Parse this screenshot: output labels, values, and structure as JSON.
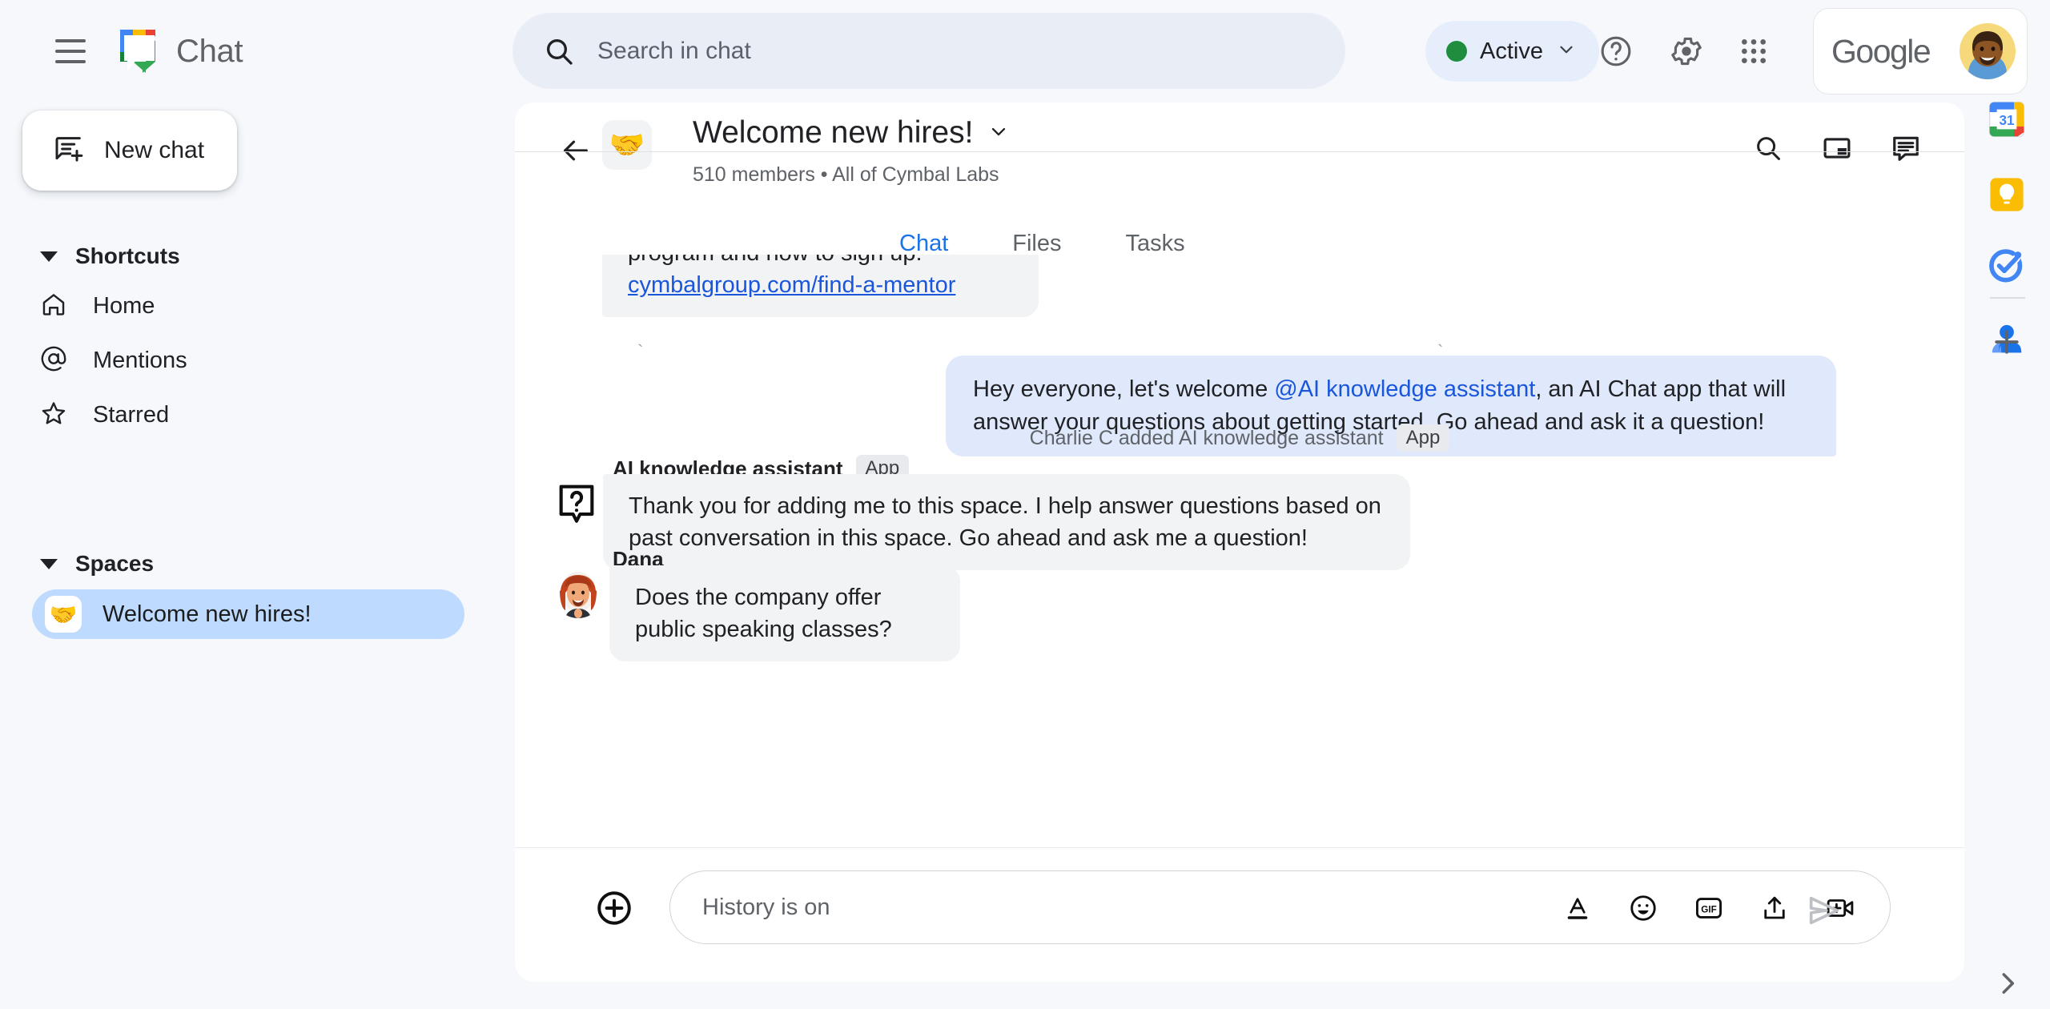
{
  "app": {
    "brand_name": "Chat",
    "menu_icon": "hamburger-icon",
    "logo_icon": "google-chat-logo"
  },
  "search": {
    "placeholder": "Search in chat",
    "icon": "search-icon"
  },
  "status": {
    "label": "Active",
    "color": "#1e8e3e",
    "chevron": "chevron-down-icon"
  },
  "topbar_icons": {
    "help": "help-circle-icon",
    "settings": "gear-icon",
    "apps": "apps-grid-icon"
  },
  "account": {
    "brand": "Google",
    "avatar": "user-avatar"
  },
  "sidebar": {
    "new_chat": {
      "label": "New chat",
      "icon": "new-chat-icon"
    },
    "shortcuts": {
      "title": "Shortcuts",
      "items": [
        {
          "label": "Home",
          "icon": "home-icon"
        },
        {
          "label": "Mentions",
          "icon": "at-sign-icon"
        },
        {
          "label": "Starred",
          "icon": "star-icon"
        }
      ]
    },
    "spaces": {
      "title": "Spaces",
      "items": [
        {
          "label": "Welcome new hires!",
          "emoji": "🤝",
          "selected": true
        }
      ]
    }
  },
  "conversation": {
    "back_icon": "back-arrow-icon",
    "emoji": "🤝",
    "title": "Welcome new hires!",
    "title_chevron": "chevron-down-icon",
    "subtitle": "510 members  •  All of Cymbal Labs",
    "member_count": "510 members",
    "org": "All of Cymbal Labs",
    "header_icons": {
      "search": "search-icon",
      "pip": "picture-in-picture-icon",
      "threads": "chat-bubble-icon"
    },
    "tabs": [
      {
        "label": "Chat",
        "active": true
      },
      {
        "label": "Files",
        "active": false
      },
      {
        "label": "Tasks",
        "active": false
      }
    ]
  },
  "messages": {
    "m1": {
      "line1": "program and how to sign up:",
      "link": "cymbalgroup.com/find-a-mentor"
    },
    "m2": {
      "before": "Hey everyone, let's welcome ",
      "mention": "@AI knowledge assistant",
      "after": ", an AI Chat app that will answer your questions about getting started.  Go ahead and ask it a question!"
    },
    "system": {
      "text": "Charlie C added AI knowledge assistant",
      "badge": "App"
    },
    "m3": {
      "sender": "AI knowledge assistant",
      "badge": "App",
      "avatar": "question-mark-app-icon",
      "text": "Thank you for adding me to this space. I help answer questions based on past conversation in this space. Go ahead and ask me a question!"
    },
    "m4": {
      "sender": "Dana",
      "avatar": "dana-avatar",
      "text": "Does the company offer public speaking classes?"
    }
  },
  "composer": {
    "plus_icon": "add-circle-icon",
    "placeholder": "History is on",
    "tools": [
      {
        "name": "format-text-icon",
        "glyph": "A"
      },
      {
        "name": "emoji-icon",
        "glyph": "☺"
      },
      {
        "name": "gif-icon",
        "glyph": "GIF"
      },
      {
        "name": "upload-icon",
        "glyph": "↑"
      },
      {
        "name": "video-add-icon",
        "glyph": "+"
      }
    ],
    "send_icon": "send-icon"
  },
  "right_rail": {
    "items": [
      {
        "name": "google-calendar-icon",
        "label": "31"
      },
      {
        "name": "google-keep-icon",
        "label": ""
      },
      {
        "name": "google-tasks-icon",
        "label": ""
      },
      {
        "name": "google-contacts-icon",
        "label": ""
      }
    ],
    "add_icon": "plus-icon",
    "expand_icon": "chevron-right-icon"
  }
}
